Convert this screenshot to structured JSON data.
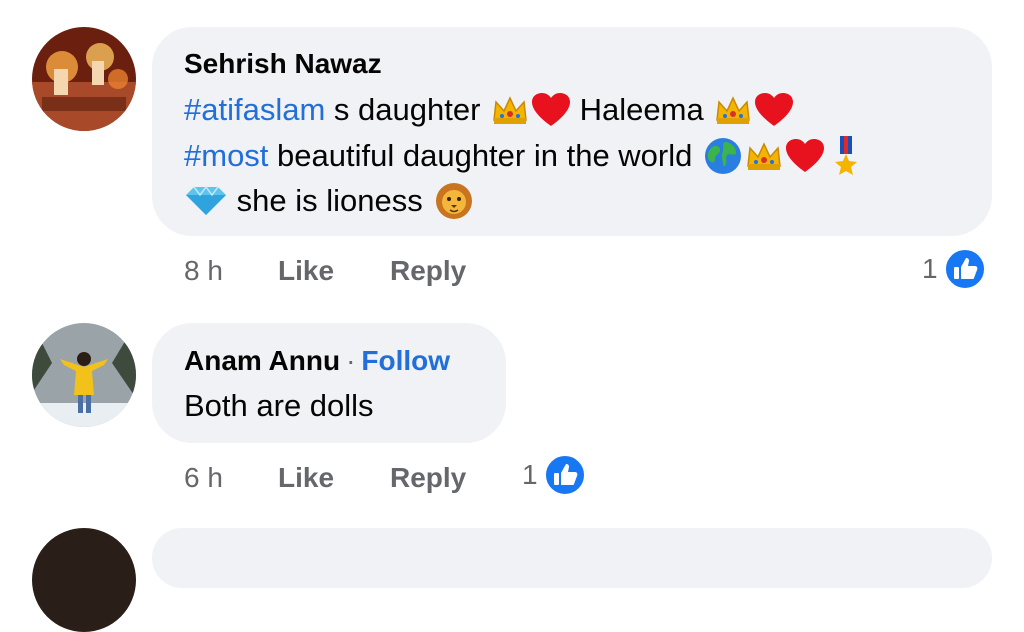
{
  "comments": [
    {
      "author": "Sehrish Nawaz",
      "line1": {
        "tag": "#atifaslam",
        "text1": " s daughter ",
        "text2": " Haleema "
      },
      "line2": {
        "tag": "#most",
        "text": " beautiful daughter in the world "
      },
      "line3": {
        "text": " she is lioness "
      },
      "time": "8 h",
      "like_label": "Like",
      "reply_label": "Reply",
      "like_count": "1"
    },
    {
      "author": "Anam Annu",
      "separator": "·",
      "follow_label": "Follow",
      "text": "Both are dolls",
      "time": "6 h",
      "like_label": "Like",
      "reply_label": "Reply",
      "like_count": "1"
    }
  ],
  "icons": [
    "crown-icon",
    "red-heart-icon",
    "globe-icon",
    "military-medal-icon",
    "gem-icon",
    "lion-face-icon",
    "like-thumb-icon"
  ],
  "colors": {
    "bubble": "#f0f2f5",
    "link": "#216fdb",
    "meta": "#65676b",
    "like_blue": "#1877f2"
  }
}
